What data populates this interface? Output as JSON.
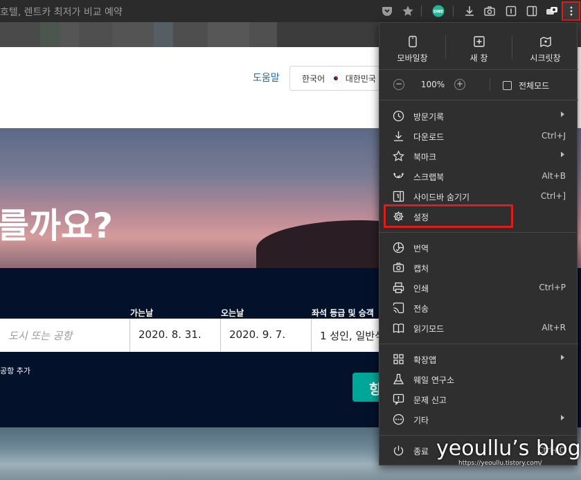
{
  "browser": {
    "address_text": "호텔, 렌트카 최저가 비교 예약",
    "toolbar_icons": [
      "pocket-icon",
      "star-icon",
      "one-badge-icon",
      "download-icon",
      "camera-icon",
      "reader-icon",
      "sidebar-icon",
      "extension-icon",
      "more-menu-icon"
    ],
    "one_badge": "ONE"
  },
  "page": {
    "help_link": "도움말",
    "language_selector": "한국어",
    "region": "대한민국",
    "hero_title": "를까요?",
    "fields": {
      "from_placeholder": "도시 또는 공항",
      "depart_label": "가는날",
      "depart_value": "2020. 8. 31.",
      "return_label": "오는날",
      "return_value": "2020. 9. 7.",
      "cabin_label": "좌석 등급 및 승객",
      "cabin_value": "1 성인, 일반석"
    },
    "add_airport": "공항 추가",
    "search_button": "항"
  },
  "menu": {
    "top_actions": [
      {
        "label": "모바일창",
        "icon": "mobile-icon"
      },
      {
        "label": "새 창",
        "icon": "new-window-icon"
      },
      {
        "label": "시크릿창",
        "icon": "secret-window-icon"
      }
    ],
    "zoom": {
      "minus": "−",
      "value": "100%",
      "plus": "+",
      "fullscreen": "전체모드"
    },
    "items": [
      {
        "label": "방문기록",
        "shortcut": "",
        "submenu": true,
        "icon": "history-icon"
      },
      {
        "label": "다운로드",
        "shortcut": "Ctrl+J",
        "submenu": false,
        "icon": "download-icon"
      },
      {
        "label": "북마크",
        "shortcut": "",
        "submenu": true,
        "icon": "bookmark-star-icon"
      },
      {
        "label": "스크랩북",
        "shortcut": "Alt+B",
        "submenu": false,
        "icon": "scrapbook-icon"
      },
      {
        "label": "사이드바 숨기기",
        "shortcut": "Ctrl+]",
        "submenu": false,
        "icon": "sidebar-toggle-icon"
      },
      {
        "label": "설정",
        "shortcut": "",
        "submenu": false,
        "icon": "gear-icon"
      },
      {
        "label": "번역",
        "shortcut": "",
        "submenu": false,
        "icon": "translate-icon"
      },
      {
        "label": "캡처",
        "shortcut": "",
        "submenu": false,
        "icon": "capture-icon"
      },
      {
        "label": "인쇄",
        "shortcut": "Ctrl+P",
        "submenu": false,
        "icon": "print-icon"
      },
      {
        "label": "전송",
        "shortcut": "",
        "submenu": false,
        "icon": "cast-icon"
      },
      {
        "label": "읽기모드",
        "shortcut": "Alt+R",
        "submenu": false,
        "icon": "reading-mode-icon"
      },
      {
        "label": "확장앱",
        "shortcut": "",
        "submenu": true,
        "icon": "extensions-icon"
      },
      {
        "label": "웨일 연구소",
        "shortcut": "",
        "submenu": false,
        "icon": "lab-flask-icon"
      },
      {
        "label": "문제 신고",
        "shortcut": "",
        "submenu": false,
        "icon": "report-icon"
      },
      {
        "label": "기타",
        "shortcut": "",
        "submenu": true,
        "icon": "more-icon"
      },
      {
        "label": "종료",
        "shortcut": "Ctrl+Q",
        "submenu": false,
        "icon": "power-icon"
      }
    ]
  },
  "watermark": {
    "title": "yeoullu’s blog",
    "url": "https://yeoullu.tistory.com/"
  }
}
